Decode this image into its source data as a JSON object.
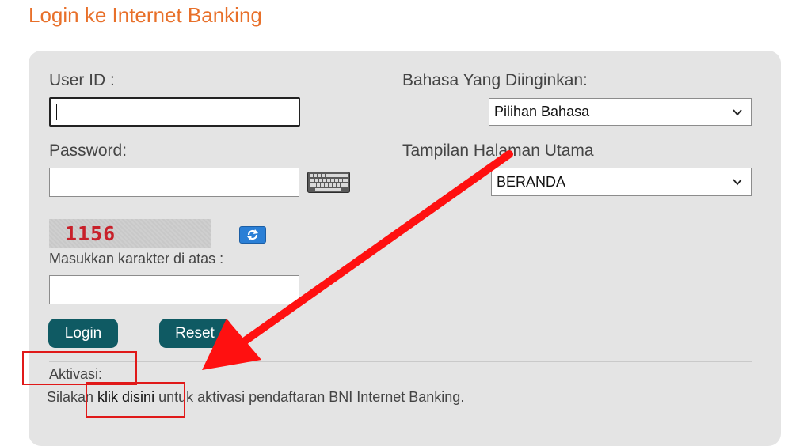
{
  "page": {
    "title": "Login ke Internet Banking"
  },
  "form": {
    "user_id_label": "User ID :",
    "user_id_value": "",
    "password_label": "Password:",
    "password_value": "",
    "captcha_code": "1156",
    "captcha_prompt": "Masukkan karakter di atas :",
    "captcha_value": "",
    "login_label": "Login",
    "reset_label": "Reset"
  },
  "settings": {
    "language_label": "Bahasa Yang Diinginkan:",
    "language_selected": "Pilihan Bahasa",
    "homepage_label": "Tampilan Halaman Utama",
    "homepage_selected": "BERANDA"
  },
  "activation": {
    "heading": "Aktivasi:",
    "text_before": "Silakan ",
    "link_text": "klik disini",
    "text_after": " untuk aktivasi pendaftaran BNI Internet Banking."
  },
  "icons": {
    "keyboard": "keyboard-icon",
    "refresh": "refresh-icon",
    "chevron": "chevron-down-icon"
  },
  "colors": {
    "title": "#e8702a",
    "panel": "#e4e4e4",
    "button": "#0f5a63",
    "annotation": "#e01919"
  }
}
